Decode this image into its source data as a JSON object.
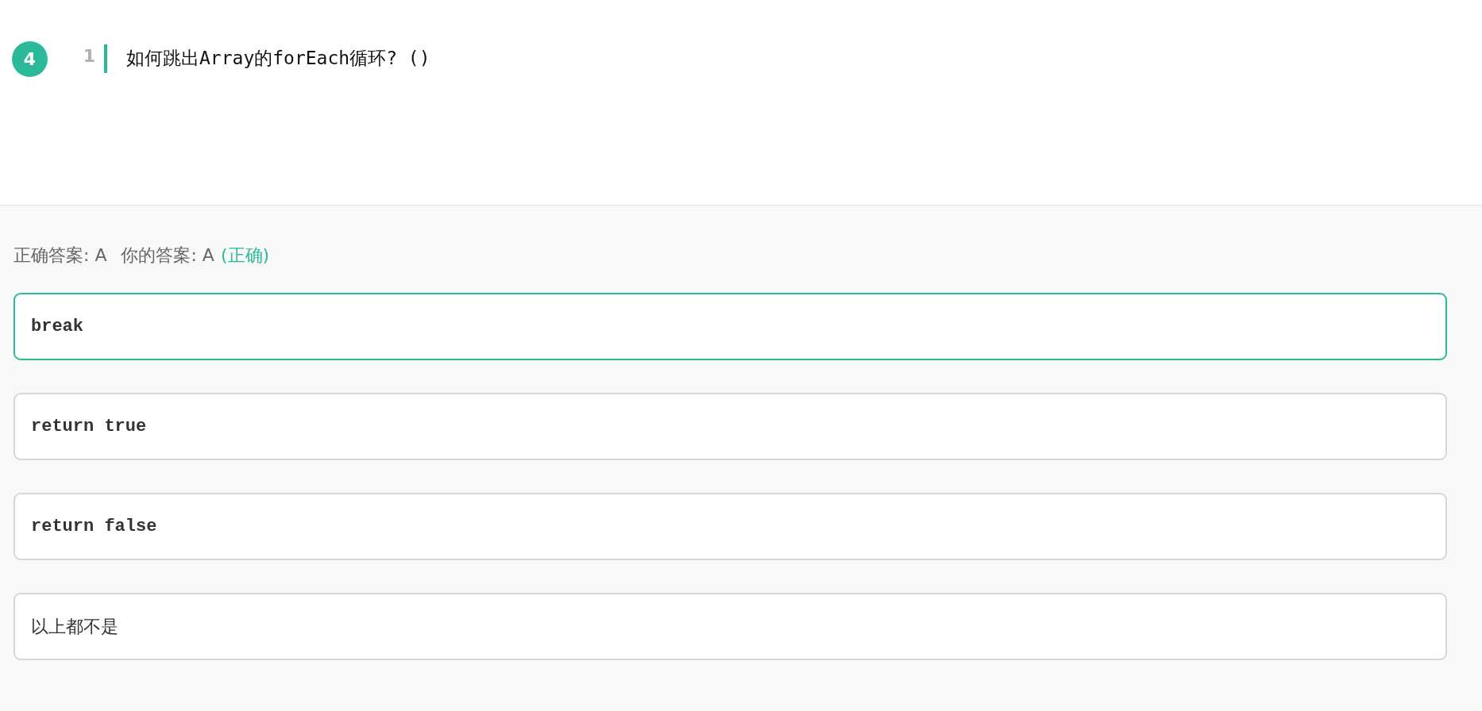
{
  "question": {
    "number": "4",
    "line_number": "1",
    "text": "如何跳出Array的forEach循环? ()"
  },
  "result": {
    "correct_answer": "正确答案: A",
    "your_answer": "你的答案: A",
    "verdict": "(正确)"
  },
  "options": [
    {
      "text": "break",
      "selected": true,
      "kind": "code"
    },
    {
      "text": "return true",
      "selected": false,
      "kind": "code"
    },
    {
      "text": "return false",
      "selected": false,
      "kind": "code"
    },
    {
      "text": "以上都不是",
      "selected": false,
      "kind": "plain"
    }
  ]
}
